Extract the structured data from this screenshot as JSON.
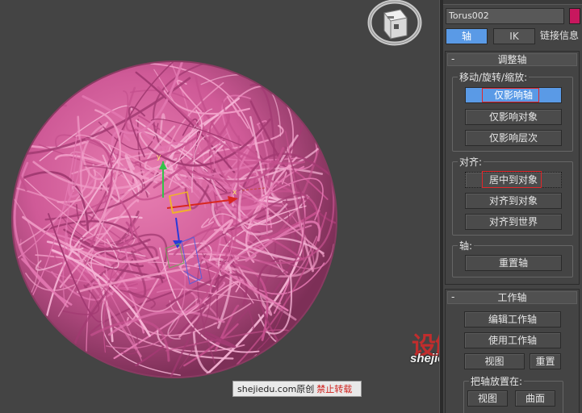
{
  "viewport": {
    "gizmo_x_label": "x",
    "gizmo_y_label": "y",
    "watermark": {
      "site": "shejiedu.com",
      "original": "原创",
      "warning": "禁止转载"
    },
    "logo": {
      "text": "设解读",
      "url": "shejiedu.com"
    }
  },
  "panel": {
    "object_name": "Torus002",
    "object_color": "#c8175e",
    "tabs": {
      "pivot": "轴",
      "ik": "IK",
      "link_info": "链接信息"
    },
    "adjust_pivot": {
      "minus": "-",
      "title": "调整轴",
      "move_rotate_scale": {
        "label": "移动/旋转/缩放:",
        "affect_pivot_only": "仅影响轴",
        "affect_object_only": "仅影响对象",
        "affect_hierarchy_only": "仅影响层次"
      },
      "alignment": {
        "label": "对齐:",
        "center_to_object": "居中到对象",
        "align_to_object": "对齐到对象",
        "align_to_world": "对齐到世界"
      },
      "pivot_group": {
        "label": "轴:",
        "reset_pivot": "重置轴"
      }
    },
    "working_pivot": {
      "minus": "-",
      "title": "工作轴",
      "edit_working_pivot": "编辑工作轴",
      "use_working_pivot": "使用工作轴",
      "align_to_view": "视图",
      "reset": "重置",
      "place_pivot_to": {
        "label": "把轴放置在:",
        "view": "视图",
        "surface": "曲面"
      }
    }
  }
}
